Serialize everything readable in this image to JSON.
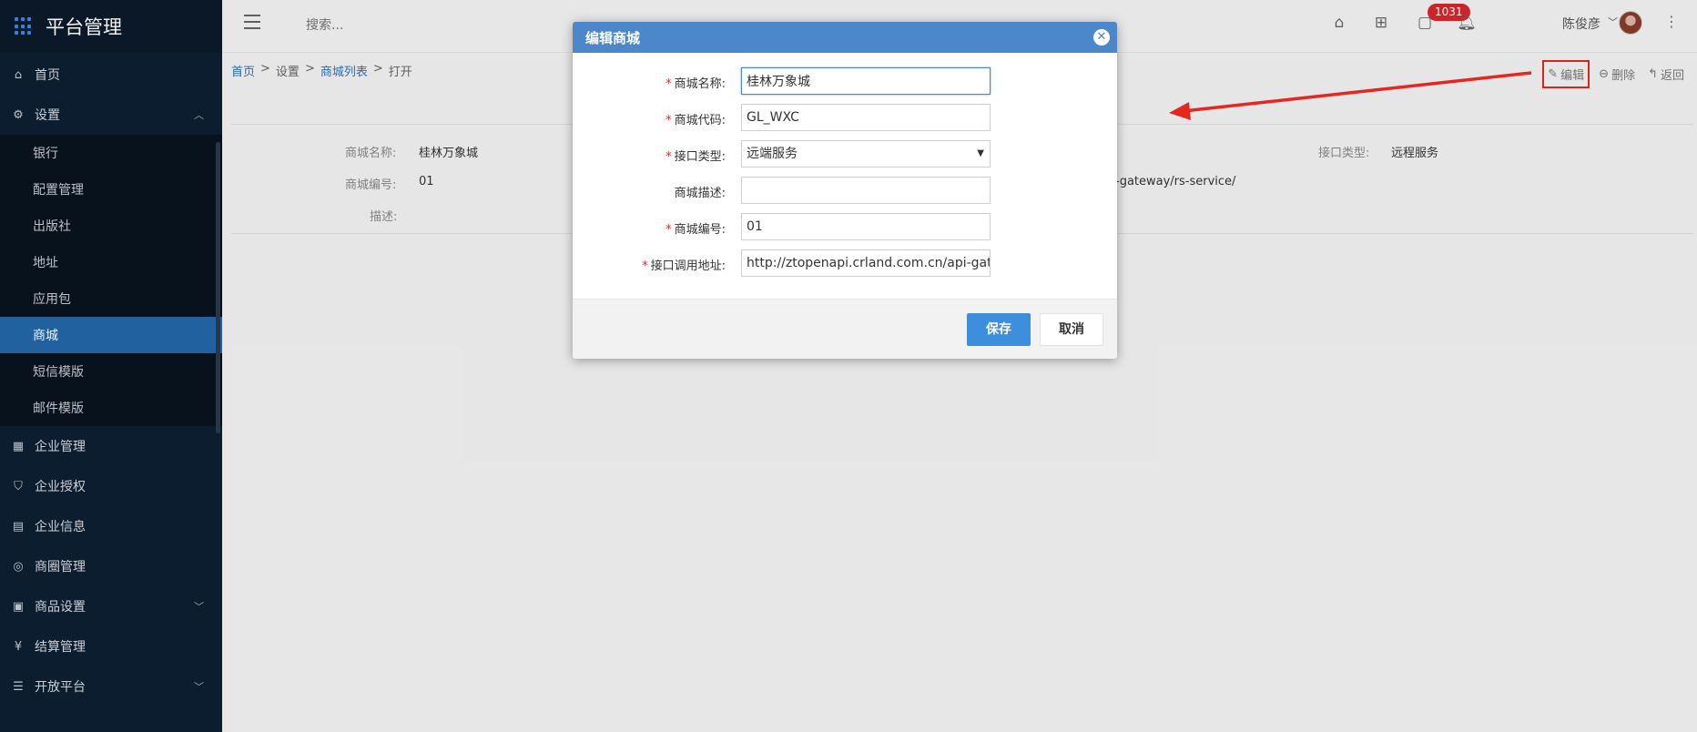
{
  "brand": {
    "title": "平台管理"
  },
  "header": {
    "search_placeholder": "搜索...",
    "notification_count": "1031",
    "user_name": "陈俊彦"
  },
  "sidebar": {
    "items": [
      {
        "label": "首页",
        "icon": "home-icon"
      },
      {
        "label": "设置",
        "icon": "gear-icon"
      },
      {
        "label": "企业管理",
        "icon": "building-icon"
      },
      {
        "label": "企业授权",
        "icon": "shield-icon"
      },
      {
        "label": "企业信息",
        "icon": "id-card-icon"
      },
      {
        "label": "商圈管理",
        "icon": "compass-icon"
      },
      {
        "label": "商品设置",
        "icon": "grid-icon"
      },
      {
        "label": "结算管理",
        "icon": "yen-icon"
      },
      {
        "label": "开放平台",
        "icon": "list-icon"
      }
    ],
    "settings_sub": [
      {
        "label": "银行"
      },
      {
        "label": "配置管理"
      },
      {
        "label": "出版社"
      },
      {
        "label": "地址"
      },
      {
        "label": "应用包"
      },
      {
        "label": "商城"
      },
      {
        "label": "短信模版"
      },
      {
        "label": "邮件模版"
      }
    ]
  },
  "breadcrumb": {
    "home": "首页",
    "settings": "设置",
    "mall_list": "商城列表",
    "current": "打开",
    "separator": ">"
  },
  "toolbar": {
    "edit": "编辑",
    "delete": "删除",
    "back": "返回"
  },
  "detail": {
    "name_label": "商城名称:",
    "name_value": "桂林万象城",
    "code_label": "商城编号:",
    "code_value": "01",
    "desc_label": "描述:",
    "api_type_label": "接口类型:",
    "api_type_value": "远程服务",
    "api_url_partial": "-gateway/rs-service/"
  },
  "dialog": {
    "title": "编辑商城",
    "fields": {
      "name": {
        "label": "商城名称:",
        "value": "桂林万象城",
        "required": true
      },
      "code": {
        "label": "商城代码:",
        "value": "GL_WXC",
        "required": true
      },
      "api_type": {
        "label": "接口类型:",
        "value": "远端服务",
        "required": true
      },
      "desc": {
        "label": "商城描述:",
        "value": "",
        "required": false
      },
      "number": {
        "label": "商城编号:",
        "value": "01",
        "required": true
      },
      "api_url": {
        "label": "接口调用地址:",
        "value": "http://ztopenapi.crland.com.cn/api-gateway/rs-service/",
        "required": true
      }
    },
    "save": "保存",
    "cancel": "取消"
  },
  "colors": {
    "sidebar_bg": "#0e1f33",
    "active_item": "#2467a8",
    "dialog_header": "#4b87c9",
    "primary_button": "#3d8fde",
    "badge": "#d6272e",
    "annotation_red": "#e5281f"
  }
}
